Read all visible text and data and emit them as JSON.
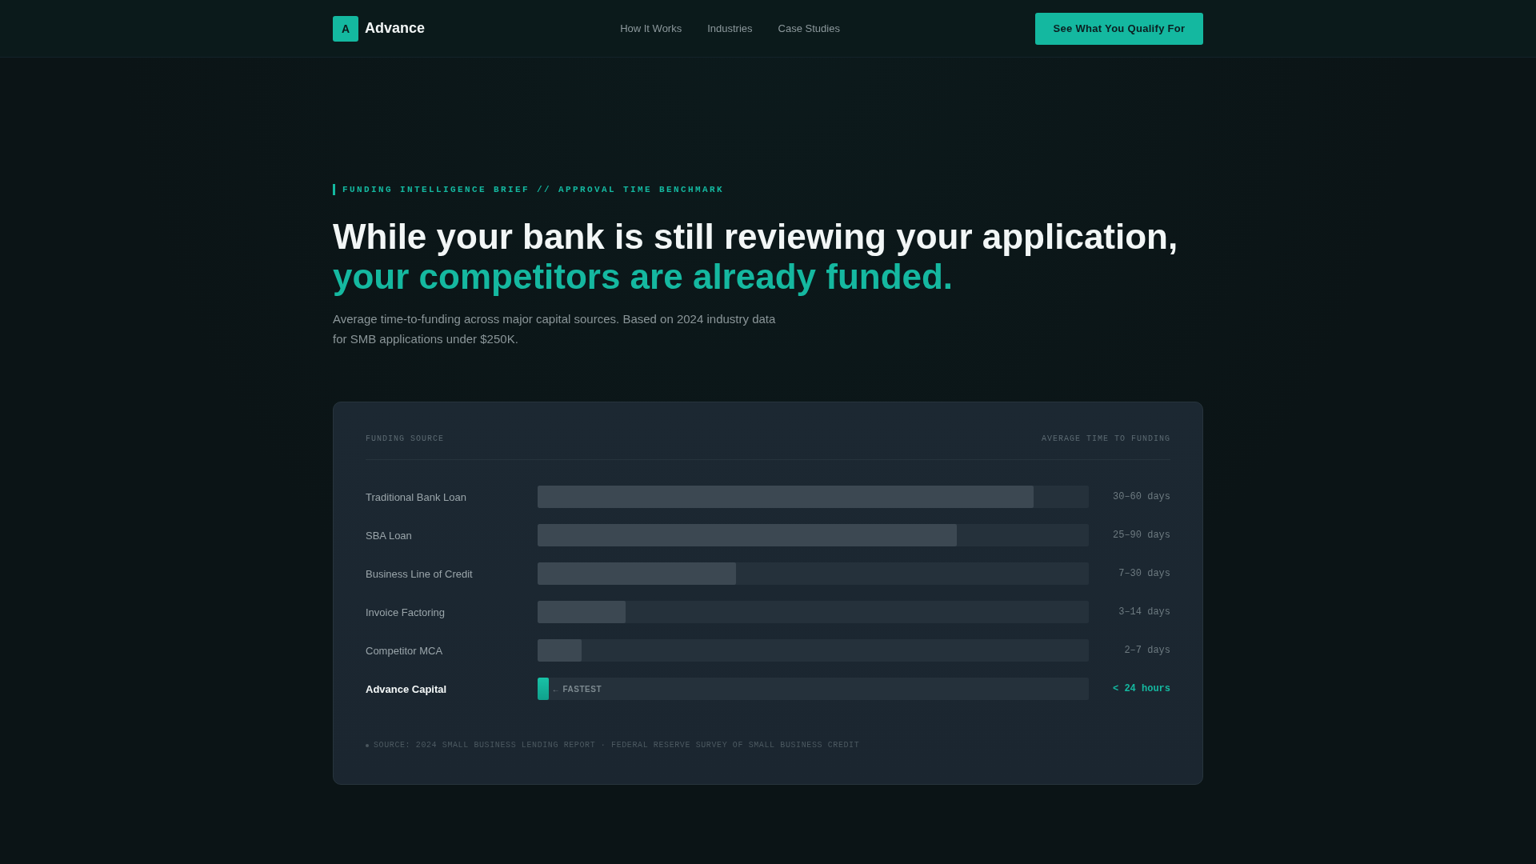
{
  "nav": {
    "logo_mark": "A",
    "brand": "Advance",
    "links": [
      "How It Works",
      "Industries",
      "Case Studies"
    ],
    "cta": "See What You Qualify For"
  },
  "hero": {
    "eyebrow": "FUNDING INTELLIGENCE BRIEF // APPROVAL TIME BENCHMARK",
    "headline": "While your bank is still reviewing your application,",
    "headline_accent": "your competitors are already funded.",
    "intro": "Average time-to-funding across major capital sources. Based on 2024 industry data for SMB applications under $250K."
  },
  "benchmark": {
    "columns": [
      "FUNDING SOURCE",
      "AVERAGE TIME TO FUNDING"
    ],
    "rows": [
      {
        "kind": "competitor",
        "name": "Traditional Bank Loan",
        "level": 0.9,
        "reading": "30–60 days"
      },
      {
        "kind": "competitor",
        "name": "SBA Loan",
        "level": 0.76,
        "reading": "25–90 days"
      },
      {
        "kind": "competitor",
        "name": "Business Line of Credit",
        "level": 0.36,
        "reading": "7–30 days"
      },
      {
        "kind": "competitor",
        "name": "Invoice Factoring",
        "level": 0.16,
        "reading": "3–14 days"
      },
      {
        "kind": "competitor",
        "name": "Competitor MCA",
        "level": 0.08,
        "reading": "2–7 days"
      },
      {
        "kind": "featured",
        "name": "Advance Capital",
        "level": 0.02,
        "reading": "< 24 hours",
        "tag": "← FASTEST"
      }
    ],
    "source": "SOURCE: 2024 SMALL BUSINESS LENDING REPORT · FEDERAL RESERVE SURVEY OF SMALL BUSINESS CREDIT"
  }
}
